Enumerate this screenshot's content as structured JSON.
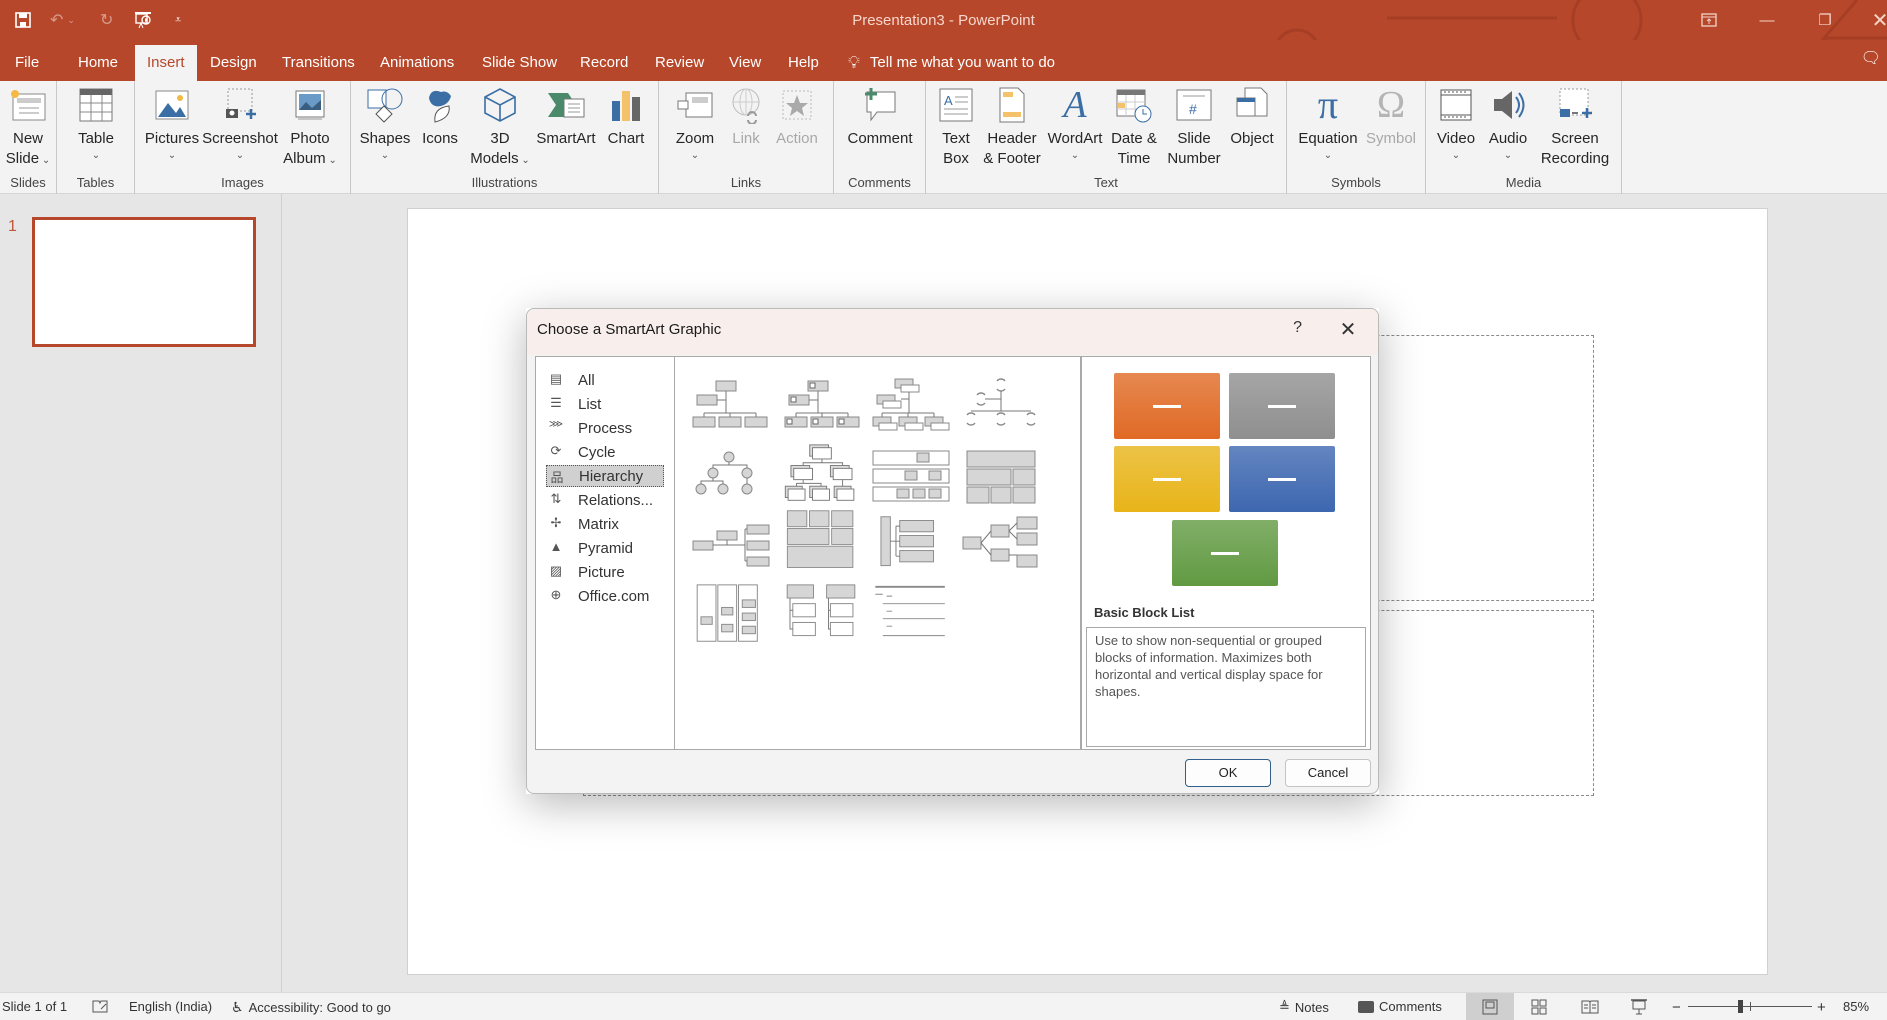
{
  "titlebar": {
    "title": "Presentation3  -  PowerPoint",
    "qat": [
      "save-icon",
      "undo-icon",
      "redo-icon",
      "present-from-beginning-icon",
      "customize-qat-icon"
    ],
    "window_controls": [
      "ribbon-display-options-icon",
      "minimize-icon",
      "restore-icon",
      "close-icon"
    ]
  },
  "tabs": [
    {
      "label": "File"
    },
    {
      "label": "Home"
    },
    {
      "label": "Insert",
      "active": true
    },
    {
      "label": "Design"
    },
    {
      "label": "Transitions"
    },
    {
      "label": "Animations"
    },
    {
      "label": "Slide Show"
    },
    {
      "label": "Record"
    },
    {
      "label": "Review"
    },
    {
      "label": "View"
    },
    {
      "label": "Help"
    }
  ],
  "tell_me": "Tell me what you want to do",
  "ribbon": {
    "groups": {
      "slides": "Slides",
      "tables": "Tables",
      "images": "Images",
      "illustrations": "Illustrations",
      "links": "Links",
      "comments": "Comments",
      "text": "Text",
      "symbols": "Symbols",
      "media": "Media"
    },
    "buttons": {
      "new_slide": [
        "New",
        "Slide"
      ],
      "table": "Table",
      "pictures": "Pictures",
      "screenshot": "Screenshot",
      "photo_album": [
        "Photo",
        "Album"
      ],
      "shapes": "Shapes",
      "icons": "Icons",
      "models_3d": [
        "3D",
        "Models"
      ],
      "smartart": "SmartArt",
      "chart": "Chart",
      "zoom": "Zoom",
      "link": "Link",
      "action": "Action",
      "comment": "Comment",
      "text_box": [
        "Text",
        "Box"
      ],
      "header_footer": [
        "Header",
        "& Footer"
      ],
      "wordart": "WordArt",
      "date_time": [
        "Date &",
        "Time"
      ],
      "slide_number": [
        "Slide",
        "Number"
      ],
      "object": "Object",
      "equation": "Equation",
      "symbol": "Symbol",
      "video": "Video",
      "audio": "Audio",
      "screen_recording": [
        "Screen",
        "Recording"
      ]
    }
  },
  "thumbnails": [
    {
      "number": "1"
    }
  ],
  "dialog": {
    "title": "Choose a SmartArt Graphic",
    "help": "?",
    "categories": [
      {
        "label": "All",
        "icon": "all-icon"
      },
      {
        "label": "List",
        "icon": "list-icon"
      },
      {
        "label": "Process",
        "icon": "process-icon"
      },
      {
        "label": "Cycle",
        "icon": "cycle-icon"
      },
      {
        "label": "Hierarchy",
        "icon": "hierarchy-icon",
        "selected": true
      },
      {
        "label": "Relations...",
        "icon": "relationship-icon"
      },
      {
        "label": "Matrix",
        "icon": "matrix-icon"
      },
      {
        "label": "Pyramid",
        "icon": "pyramid-icon"
      },
      {
        "label": "Picture",
        "icon": "picture-icon"
      },
      {
        "label": "Office.com",
        "icon": "globe-icon"
      }
    ],
    "gallery_count": 15,
    "preview": {
      "name": "Basic Block List",
      "description": "Use to show non-sequential or grouped blocks of information. Maximizes both horizontal and vertical display space for shapes.",
      "colors": [
        "#e06a25",
        "#8f8f8f",
        "#e8b419",
        "#3d67b0",
        "#619a42"
      ]
    },
    "ok_label": "OK",
    "cancel_label": "Cancel"
  },
  "statusbar": {
    "slide_info": "Slide 1 of 1",
    "language": "English (India)",
    "accessibility": "Accessibility: Good to go",
    "notes": "Notes",
    "comments": "Comments",
    "zoom_level": "85%",
    "zoom_fraction": 0.42
  }
}
